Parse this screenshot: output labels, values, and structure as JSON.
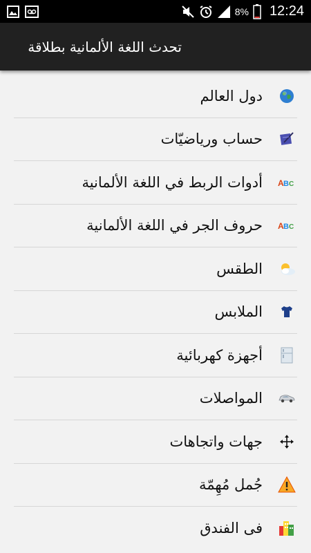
{
  "status_bar": {
    "battery_percent": "8%",
    "time": "12:24",
    "left_icons": [
      "image-icon",
      "voicemail-icon"
    ],
    "right_icons": [
      "mute-icon",
      "alarm-icon",
      "signal-icon",
      "battery-icon"
    ]
  },
  "app_bar": {
    "title": "تحدث اللغة الألمانية بطلاقة"
  },
  "menu": {
    "items": [
      {
        "label": "دول العالم",
        "icon": "globe-icon"
      },
      {
        "label": "حساب ورياضيّات",
        "icon": "notebook-pen-icon"
      },
      {
        "label": "أدوات الربط في اللغة الألمانية",
        "icon": "abc-icon"
      },
      {
        "label": "حروف الجر في اللغة الألمانية",
        "icon": "abc-icon"
      },
      {
        "label": "الطقس",
        "icon": "sun-cloud-icon"
      },
      {
        "label": "الملابس",
        "icon": "tshirt-icon"
      },
      {
        "label": "أجهزة كهربائية",
        "icon": "fridge-icon"
      },
      {
        "label": "المواصلات",
        "icon": "car-icon"
      },
      {
        "label": "جهات واتجاهات",
        "icon": "directions-arrows-icon"
      },
      {
        "label": "جُمل مُهِمّة",
        "icon": "warning-icon"
      },
      {
        "label": "فى الفندق",
        "icon": "hotel-buildings-icon"
      }
    ]
  }
}
